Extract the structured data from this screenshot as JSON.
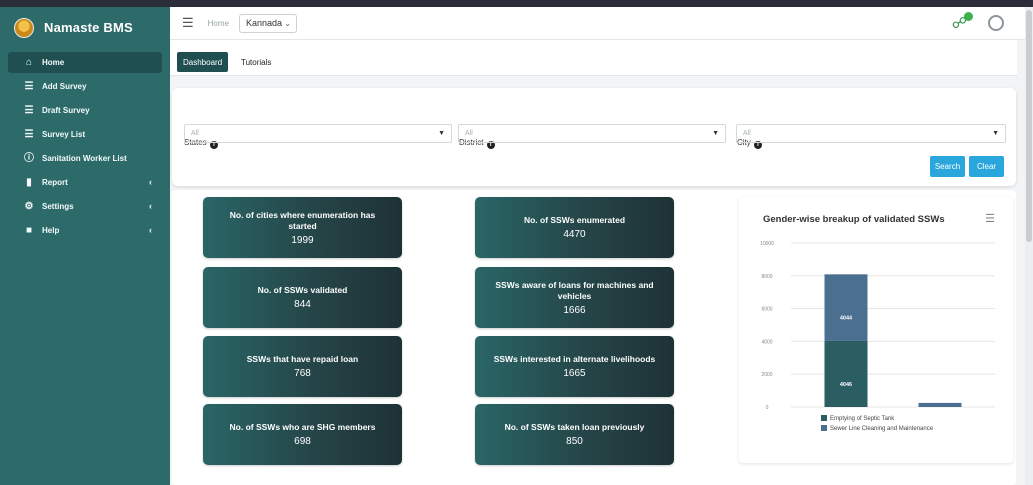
{
  "app": {
    "name": "Namaste BMS"
  },
  "sidebar": {
    "items": [
      {
        "label": "Home",
        "icon": "home-icon"
      },
      {
        "label": "Add Survey",
        "icon": "list-icon"
      },
      {
        "label": "Draft Survey",
        "icon": "list-icon"
      },
      {
        "label": "Survey List",
        "icon": "list-icon"
      },
      {
        "label": "Sanitation Worker List",
        "icon": "info-icon"
      },
      {
        "label": "Report",
        "icon": "file-icon"
      },
      {
        "label": "Settings",
        "icon": "gear-icon"
      },
      {
        "label": "Help",
        "icon": "folder-icon"
      }
    ]
  },
  "header": {
    "home": "Home",
    "language": "Kannada"
  },
  "tabs": {
    "dashboard": "Dashboard",
    "tutorials": "Tutorials"
  },
  "filters": {
    "states_label": "States",
    "district_label": "District",
    "city_label": "City",
    "states_value": "All",
    "district_value": "All",
    "city_value": "All",
    "search": "Search",
    "clear": "Clear"
  },
  "stats": [
    {
      "label": "No. of cities where enumeration has started",
      "value": "1999"
    },
    {
      "label": "No. of SSWs enumerated",
      "value": "4470"
    },
    {
      "label": "No. of SSWs validated",
      "value": "844"
    },
    {
      "label": "SSWs aware of loans for machines and vehicles",
      "value": "1666"
    },
    {
      "label": "SSWs that have repaid loan",
      "value": "768"
    },
    {
      "label": "SSWs interested in alternate livelihoods",
      "value": "1665"
    },
    {
      "label": "No. of SSWs who are SHG members",
      "value": "698"
    },
    {
      "label": "No. of SSWs taken loan previously",
      "value": "850"
    }
  ],
  "chart_data": {
    "type": "bar",
    "stacked": true,
    "title": "Gender-wise breakup of validated SSWs",
    "categories": [
      "",
      ""
    ],
    "series": [
      {
        "name": "Emptying of Septic Tank",
        "values": [
          4046,
          0
        ],
        "color": "#2b5e63"
      },
      {
        "name": "Sewer Line Cleaning and Maintenance",
        "values": [
          4044,
          250
        ],
        "color": "#4b6f91"
      }
    ],
    "data_labels": [
      "4046",
      "4044"
    ],
    "yticks": [
      "10000",
      "8000",
      "6000",
      "4000",
      "2000",
      "0"
    ],
    "ylim": [
      0,
      10000
    ],
    "legend_position": "bottom",
    "grid": true
  }
}
